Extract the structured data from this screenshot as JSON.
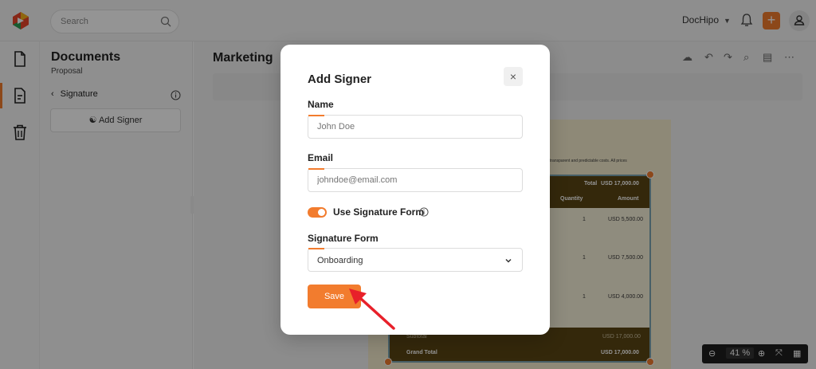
{
  "topbar": {
    "search_placeholder": "Search",
    "brand": "DocHipo",
    "plus": "+"
  },
  "panel": {
    "title": "Documents",
    "subtitle": "Proposal",
    "back_label": "Signature",
    "add_signer_label": "Add Signer"
  },
  "document": {
    "title": "Marketing",
    "intro_fragment": "transparent and predictable costs. All prices",
    "table": {
      "total_label": "Total",
      "total_value": "USD 17,000.00",
      "col_quantity": "Quantity",
      "col_amount": "Amount",
      "rows": [
        {
          "quantity": "1",
          "amount": "USD 5,500.00"
        },
        {
          "quantity": "1",
          "amount": "USD 7,500.00"
        },
        {
          "quantity": "1",
          "amount": "USD 4,000.00"
        }
      ],
      "subtotal_label": "Subtotal",
      "subtotal_value": "USD 17,000.00",
      "grand_total_label": "Grand Total",
      "grand_total_value": "USD 17,000.00"
    }
  },
  "zoom": {
    "value": "41",
    "unit": "%"
  },
  "modal": {
    "title": "Add Signer",
    "close": "×",
    "name_label": "Name",
    "name_placeholder": "John Doe",
    "email_label": "Email",
    "email_placeholder": "johndoe@email.com",
    "toggle_label": "Use Signature Form",
    "toggle_on": true,
    "form_label": "Signature Form",
    "form_selected": "Onboarding",
    "save_label": "Save"
  },
  "colors": {
    "accent": "#f27c2e",
    "table_dark": "#5a4513",
    "page_bg": "#f5edcd",
    "arrow": "#e8202a"
  }
}
